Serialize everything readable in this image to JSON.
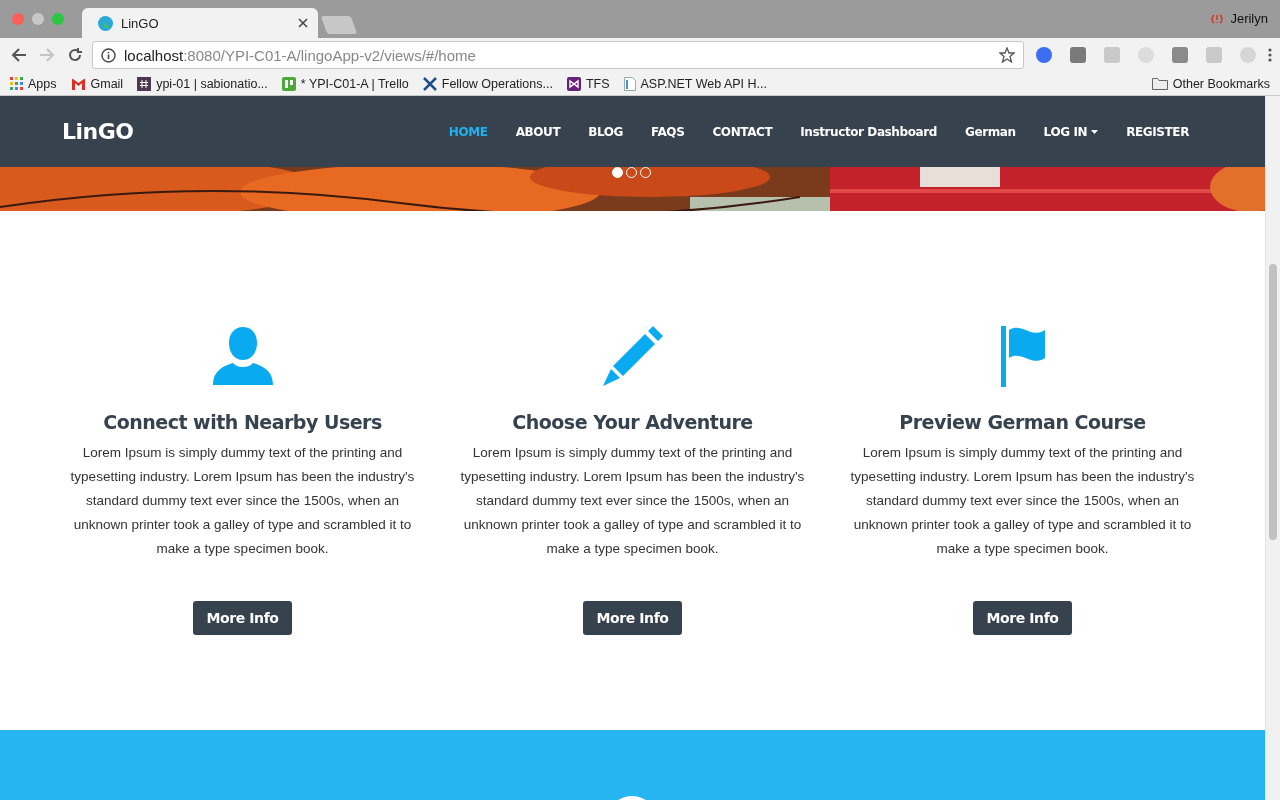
{
  "browser": {
    "tab": {
      "title": "LinGO"
    },
    "profile": "Jerilyn",
    "nav_buttons": [
      {
        "kind": "back",
        "disabled": false
      },
      {
        "kind": "forward",
        "disabled": true
      },
      {
        "kind": "reload",
        "disabled": false
      }
    ],
    "address": {
      "host": "localhost",
      "path": ":8080/YPI-C01-A/lingoApp-v2/views/#/home"
    },
    "bookmarks": [
      {
        "kind": "apps",
        "label": "Apps"
      },
      {
        "kind": "gmail",
        "label": "Gmail"
      },
      {
        "kind": "slack",
        "label": "ypi-01 | sabionatio..."
      },
      {
        "kind": "trello",
        "label": "* YPI-C01-A | Trello"
      },
      {
        "kind": "tools",
        "label": "Fellow Operations..."
      },
      {
        "kind": "vs",
        "label": "TFS"
      },
      {
        "kind": "doc",
        "label": "ASP.NET Web API H..."
      }
    ],
    "other_bookmarks": "Other Bookmarks"
  },
  "site": {
    "brand": "LinGO",
    "nav": [
      {
        "label": "HOME",
        "selected": true
      },
      {
        "label": "ABOUT",
        "selected": false
      },
      {
        "label": "BLOG",
        "selected": false
      },
      {
        "label": "FAQS",
        "selected": false
      },
      {
        "label": "CONTACT",
        "selected": false
      },
      {
        "label": "Instructor Dashboard",
        "selected": false
      },
      {
        "label": "German",
        "selected": false
      },
      {
        "label": "LOG IN",
        "selected": false,
        "kind": "dropdown"
      },
      {
        "label": "REGISTER",
        "selected": false
      }
    ],
    "hero": {
      "kind": "picture",
      "slides": [
        {
          "selected": true
        },
        {
          "selected": false
        },
        {
          "selected": false
        }
      ]
    },
    "features": [
      {
        "kind": "user",
        "title": "Connect with Nearby Users",
        "text": "Lorem Ipsum is simply dummy text of the printing and typesetting industry. Lorem Ipsum has been the industry's standard dummy text ever since the 1500s, when an unknown printer took a galley of type and scrambled it to make a type specimen book.",
        "button": "More Info"
      },
      {
        "kind": "pencil",
        "title": "Choose Your Adventure",
        "text": "Lorem Ipsum is simply dummy text of the printing and typesetting industry. Lorem Ipsum has been the industry's standard dummy text ever since the 1500s, when an unknown printer took a galley of type and scrambled it to make a type specimen book.",
        "button": "More Info"
      },
      {
        "kind": "flag",
        "title": "Preview German Course",
        "text": "Lorem Ipsum is simply dummy text of the printing and typesetting industry. Lorem Ipsum has been the industry's standard dummy text ever since the 1500s, when an unknown printer took a galley of type and scrambled it to make a type specimen book.",
        "button": "More Info"
      }
    ]
  }
}
